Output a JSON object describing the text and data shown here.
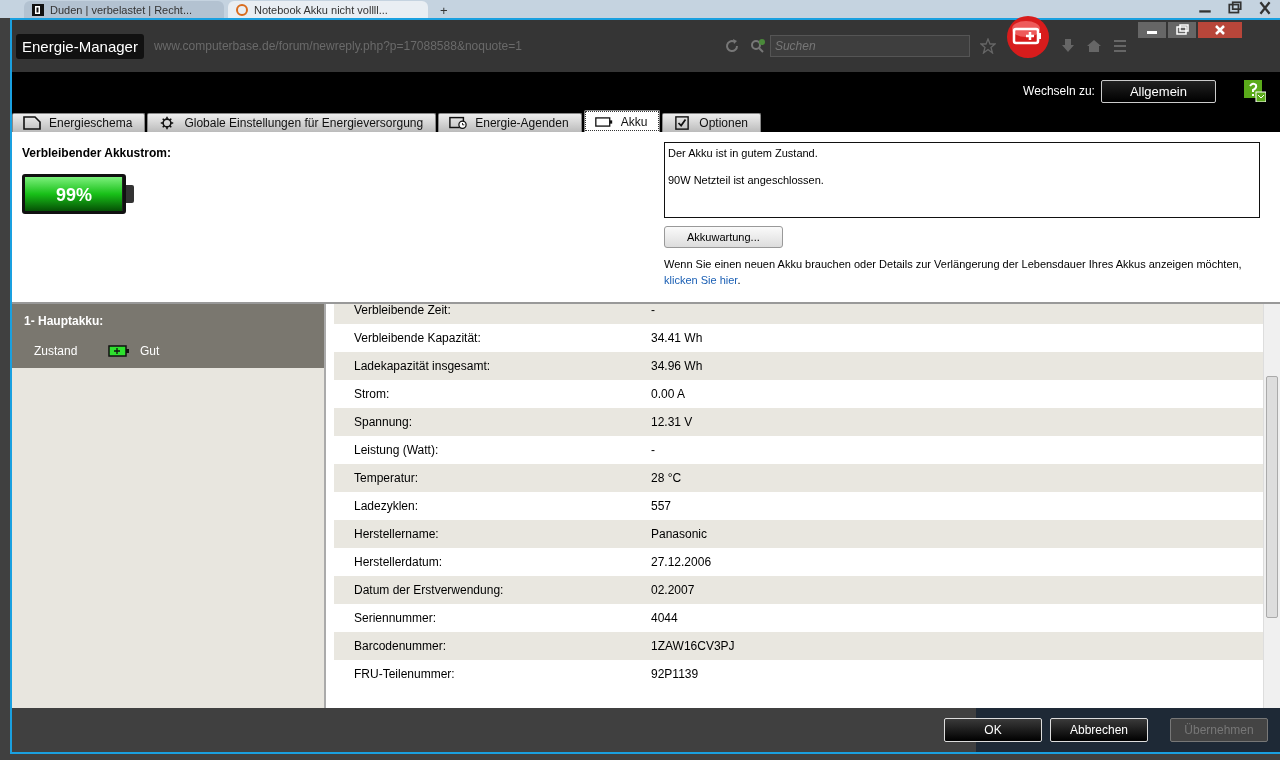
{
  "browser": {
    "tabs": [
      {
        "title": "Duden | verbelastet | Recht...",
        "selected": false
      },
      {
        "title": "Notebook Akku nicht vollll...",
        "selected": true
      }
    ],
    "new_tab": "+",
    "url": "www.computerbase.de/forum/newreply.php?p=17088588&noquote=1",
    "search": {
      "placeholder": "Suchen"
    }
  },
  "window": {
    "title": "Energie-Manager"
  },
  "switch": {
    "label": "Wechseln zu:",
    "button": "Allgemein"
  },
  "tabs": [
    {
      "label": "Energieschema",
      "selected": false
    },
    {
      "label": "Globale Einstellungen für Energieversorgung",
      "selected": false
    },
    {
      "label": "Energie-Agenden",
      "selected": false
    },
    {
      "label": "Akku",
      "selected": true
    },
    {
      "label": "Optionen",
      "selected": false
    }
  ],
  "battery": {
    "heading": "Verbleibender Akkustrom:",
    "level": 0.99,
    "reading": "99%"
  },
  "status": {
    "lines": [
      "Der Akku ist in gutem Zustand.",
      "90W Netzteil ist angeschlossen."
    ],
    "button": "Akkuwartung...",
    "note": "Wenn Sie einen neuen Akku brauchen oder Details zur Verlängerung der Lebensdauer Ihres Akkus anzeigen möchten, ",
    "link": "klicken Sie hier",
    "note_end": "."
  },
  "sidebar": {
    "title": "1- Hauptakku:",
    "rows": [
      {
        "label": "Zustand",
        "value": "Gut"
      }
    ]
  },
  "details": [
    {
      "label": "Verbleibende Zeit:",
      "value": "-"
    },
    {
      "label": "Verbleibende Kapazität:",
      "value": "34.41 Wh"
    },
    {
      "label": "Ladekapazität insgesamt:",
      "value": "34.96 Wh"
    },
    {
      "label": "Strom:",
      "value": "0.00 A"
    },
    {
      "label": "Spannung:",
      "value": "12.31 V"
    },
    {
      "label": "Leistung (Watt):",
      "value": "-"
    },
    {
      "label": "Temperatur:",
      "value": "28 °C"
    },
    {
      "label": "Ladezyklen:",
      "value": "557"
    },
    {
      "label": "Herstellername:",
      "value": "Panasonic"
    },
    {
      "label": "Herstellerdatum:",
      "value": "27.12.2006"
    },
    {
      "label": "Datum der Erstverwendung:",
      "value": "02.2007"
    },
    {
      "label": "Seriennummer:",
      "value": "4044"
    },
    {
      "label": "Barcodenummer:",
      "value": "1ZAW16CV3PJ"
    },
    {
      "label": "FRU-Teilenummer:",
      "value": "92P1139"
    }
  ],
  "footer": [
    {
      "label": "OK",
      "disabled": false
    },
    {
      "label": "Abbrechen",
      "disabled": false
    },
    {
      "label": "Übernehmen",
      "disabled": true
    }
  ]
}
